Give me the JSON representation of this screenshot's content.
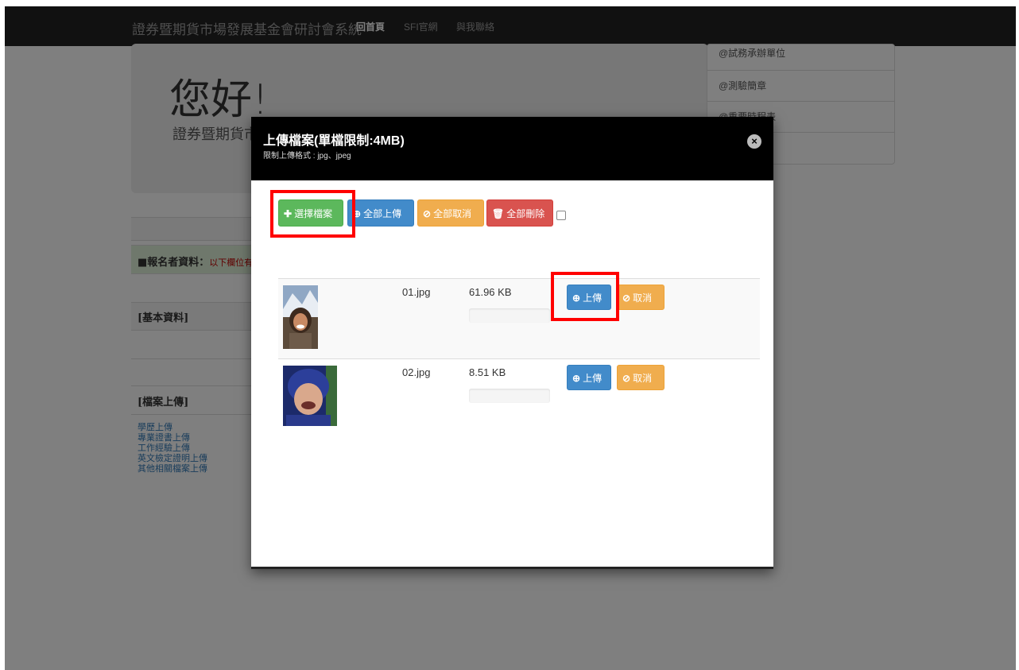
{
  "navbar": {
    "brand": "證券暨期貨市場發展基金會研討會系統",
    "links": [
      "回首頁",
      "SFI官網",
      "與我聯絡"
    ]
  },
  "background": {
    "hero_title": "您好!",
    "hero_subtitle": "證券暨期貨市",
    "right_menu": [
      "@試務承辦單位",
      "@測驗簡章",
      "@重要時程表"
    ],
    "registrant_label": "報名者資料：",
    "registrant_note": "以下欄位有",
    "basic_info_label": "[基本資料]",
    "file_upload_label": "[檔案上傳]",
    "upload_links": [
      "學歷上傳",
      "專業證書上傳",
      "工作經驗上傳",
      "英文檢定證明上傳",
      "其他相關檔案上傳"
    ]
  },
  "modal": {
    "title": "上傳檔案(單檔限制:4MB)",
    "subtitle": "限制上傳格式 : jpg、jpeg",
    "close_icon": "×",
    "toolbar": {
      "choose_label": "選擇檔案",
      "upload_all_label": "全部上傳",
      "cancel_all_label": "全部取消",
      "delete_all_label": "全部刪除"
    },
    "files": [
      {
        "name": "01.jpg",
        "size": "61.96 KB",
        "upload_label": "上傳",
        "cancel_label": "取消"
      },
      {
        "name": "02.jpg",
        "size": "8.51 KB",
        "upload_label": "上傳",
        "cancel_label": "取消"
      }
    ]
  },
  "icons": {
    "plus": "✚",
    "upload": "⊕",
    "cancel": "⊘",
    "trash": "🗑"
  },
  "colors": {
    "success": "#5cb85c",
    "primary": "#428bca",
    "warning": "#f0ad4e",
    "danger": "#d9534f",
    "annotation": "#ff0000"
  }
}
